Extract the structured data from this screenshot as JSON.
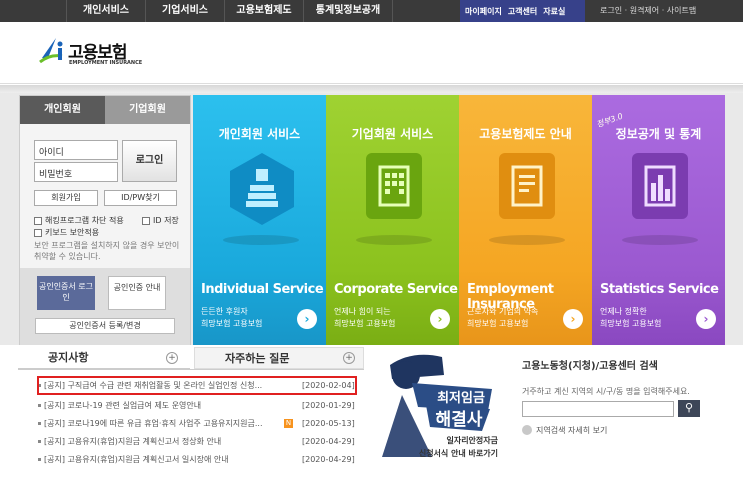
{
  "topnav": {
    "items": [
      "개인서비스",
      "기업서비스",
      "고용보험제도",
      "통계및정보공개"
    ],
    "sublinks": [
      "마이페이지",
      "고객센터",
      "자료실"
    ],
    "utility": "로그인 · 원격제어 · 사이트맵"
  },
  "logo": {
    "title": "고용보험",
    "subtitle": "EMPLOYMENT INSURANCE"
  },
  "login": {
    "tab_personal": "개인회원",
    "tab_corporate": "기업회원",
    "id_placeholder": "아이디",
    "pw_placeholder": "비밀번호",
    "login_button": "로그인",
    "join_button": "회원가입",
    "find_button": "ID/PW찾기",
    "hacking_block": "해킹프로그램 차단 적용",
    "id_save": "ID 저장",
    "keyboard_security": "키보드 보안적용",
    "security_note": "보안 프로그램을 설치하지 않을 경우 보안이 취약할 수 있습니다.",
    "cert_login": "공인인증서 로그인",
    "cert_guide": "공인인증 안내",
    "cert_register": "공인인증서 등록/변경"
  },
  "panels": [
    {
      "title": "개인회원 서비스",
      "en": "Individual Service",
      "desc1": "든든한 후원자",
      "desc2": "희망보험 고용보험",
      "color": "#1eaee0"
    },
    {
      "title": "기업회원 서비스",
      "en": "Corporate Service",
      "desc1": "언제나 힘이 되는",
      "desc2": "희망보험 고용보험",
      "color": "#8dc21f"
    },
    {
      "title": "고용보험제도 안내",
      "en": "Employment Insurance",
      "desc1": "근로자와 기업의 약속",
      "desc2": "희망보험 고용보험",
      "color": "#f5a623"
    },
    {
      "title": "정보공개 및 통계",
      "stamp": "정부3.0",
      "en": "Statistics Service",
      "desc1": "언제나 정확한",
      "desc2": "희망보험 고용보험",
      "color": "#9b59d0"
    }
  ],
  "notice": {
    "tab_notice": "공지사항",
    "tab_faq": "자주하는 질문",
    "items": [
      {
        "text": "[공지] 구직급여 수급 관련 재취업활동 및 온라인 실업인정 신청...",
        "date": "[2020-02-04]"
      },
      {
        "text": "[공지] 코로나-19 관련 실업급여 제도 운영안내",
        "date": "[2020-01-29]"
      },
      {
        "text": "[공지] 코로나19에 따른 유급 휴업·휴직 사업주 고용유지지원금...",
        "date": "[2020-05-13]",
        "badge": "N"
      },
      {
        "text": "[공지] 고용유지(휴업)지원금 계획신고서 정상화 안내",
        "date": "[2020-04-29]"
      },
      {
        "text": "[공지] 고용유지(휴업)지원금 계획신고서 일시장애 안내",
        "date": "[2020-04-29]"
      }
    ]
  },
  "banner": {
    "line1": "최저임금",
    "line2": "해결사",
    "sub1": "일자리안정자금",
    "sub2": "신청서식 안내 바로가기"
  },
  "center_search": {
    "title": "고용노동청(지청)/고용센터 검색",
    "hint": "거주하고 계신 지역의 시/구/동 명을 입력해주세요.",
    "detail_link": "지역검색 자세히 보기"
  }
}
